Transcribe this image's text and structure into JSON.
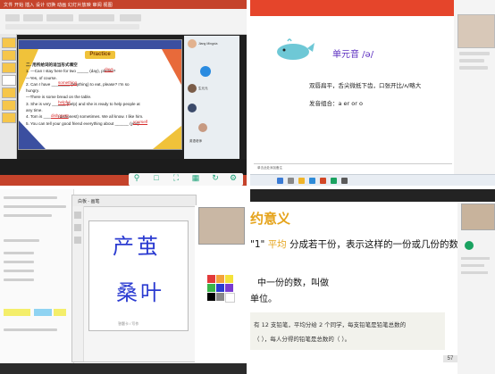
{
  "q1": {
    "tabs": "文件  开始  插入  设计  切换  动画  幻灯片放映  审阅  视图",
    "practice_label": "Practice",
    "section_heading": "二. 用所给词的适当形式填空",
    "lines": [
      "1. —Can I stay here for two _____ (day), please?",
      "—Yes, of course.",
      "2. Can I have ________ (anything) to eat, please? I'm so",
      "hungry.",
      "—There is some bread on the table.",
      "3. She is very ______ (help) and she is ready to help people at",
      "any time.",
      "4. Tom is ______ (dishonest) sometimes. We all know. I like him.",
      "5. You can tell your good friend everything about ______ (you)."
    ],
    "answers": [
      "days",
      "something",
      "helpful",
      "dishonest",
      "yourself"
    ],
    "participants": [
      "Jiang Mingxia",
      "生元元",
      "英语老师"
    ]
  },
  "q2": {
    "title": "单元音 /ə/",
    "line1": "双唇扁平，舌尖微抵下齿，口张开比/ʌ/略大",
    "line2": "发音组合：a  er  or  o",
    "footer": "单击此处添加备注"
  },
  "q3": {
    "window_title": "白板 - 画笔",
    "handwriting_1": "产茧",
    "handwriting_2": "桑叶",
    "caption": "答题卡 / 写作"
  },
  "q4": {
    "heading": "约意义",
    "line1_num": "\"1\"",
    "line1_kw": "平均",
    "line1_rest": "分成若干份，表示这样的一份或几份的数",
    "line2": "中一份的数，叫做",
    "line3": "单位。",
    "problem_1": "有 12 支铅笔，平均分给 2 个同学，每支铅笔是铅笔总数的",
    "problem_2": "（   ），每人分得的铅笔是总数的（   ）。",
    "page_number": "57"
  },
  "colors": {
    "ppt_red": "#c5432b",
    "title_purple": "#5c2fc0",
    "heading_orange": "#e5a31a",
    "ink_blue": "#2b3bd1",
    "tool_green": "#1fa37a"
  }
}
